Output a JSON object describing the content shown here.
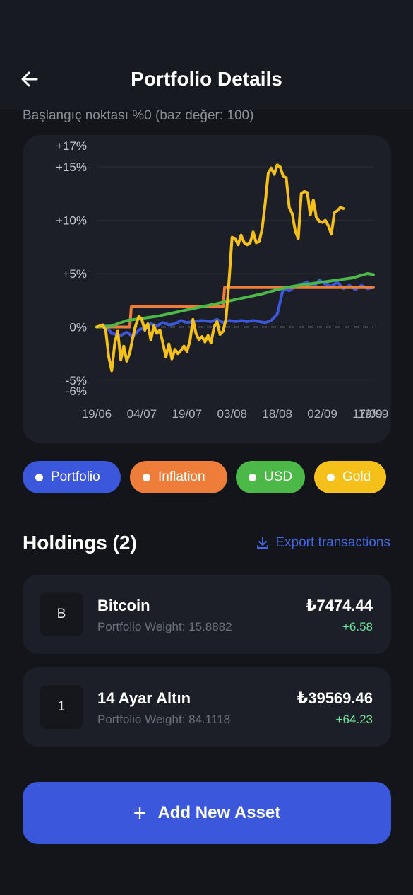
{
  "header": {
    "title": "Portfolio Details",
    "back_icon": "arrow-left-icon"
  },
  "subtitle": "Başlangıç noktası %0 (baz değer: 100)",
  "chart_data": {
    "type": "line",
    "ylim": [
      -6,
      17
    ],
    "y_ticks": [
      "+17%",
      "+15%",
      "+10%",
      "+5%",
      "0%",
      "-5%",
      "-6%"
    ],
    "y_tick_values": [
      17,
      15,
      10,
      5,
      0,
      -5,
      -6
    ],
    "gridlines": [
      15,
      10,
      5,
      -5
    ],
    "zero_line": "dashed",
    "x_ticks": [
      "19/06",
      "04/07",
      "19/07",
      "03/08",
      "18/08",
      "02/09",
      "17/09",
      "19/09"
    ],
    "x_tick_days": [
      0,
      15,
      30,
      45,
      60,
      75,
      90,
      92
    ],
    "x_range_days": [
      0,
      92
    ],
    "series": [
      {
        "name": "Portfolio",
        "color": "#3b57dc",
        "points": [
          [
            0,
            0
          ],
          [
            3,
            0.1
          ],
          [
            5,
            -0.6
          ],
          [
            8,
            -0.8
          ],
          [
            10,
            -0.5
          ],
          [
            12,
            -0.9
          ],
          [
            14,
            -0.3
          ],
          [
            16,
            0
          ],
          [
            18,
            0.3
          ],
          [
            20,
            0.1
          ],
          [
            22,
            0.4
          ],
          [
            24,
            0.2
          ],
          [
            26,
            0.3
          ],
          [
            28,
            0.6
          ],
          [
            30,
            0.4
          ],
          [
            32,
            0.5
          ],
          [
            35,
            0.6
          ],
          [
            38,
            0.5
          ],
          [
            40,
            0.7
          ],
          [
            42,
            0.4
          ],
          [
            44,
            0.6
          ],
          [
            46,
            0.5
          ],
          [
            48,
            0.6
          ],
          [
            50,
            0.5
          ],
          [
            52,
            0.6
          ],
          [
            54,
            0.5
          ],
          [
            56,
            0.4
          ],
          [
            58,
            0.6
          ],
          [
            60,
            1.2
          ],
          [
            62,
            3.6
          ],
          [
            64,
            3.4
          ],
          [
            66,
            3.8
          ],
          [
            68,
            4
          ],
          [
            70,
            4.2
          ],
          [
            72,
            3.7
          ],
          [
            74,
            4.4
          ],
          [
            76,
            4
          ],
          [
            78,
            3.8
          ],
          [
            80,
            4.2
          ],
          [
            82,
            3.6
          ],
          [
            84,
            3.9
          ],
          [
            86,
            3.5
          ],
          [
            88,
            3.9
          ],
          [
            90,
            3.6
          ],
          [
            92,
            3.7
          ]
        ]
      },
      {
        "name": "Inflation",
        "color": "#ee7d3a",
        "points": [
          [
            0,
            0
          ],
          [
            11,
            0
          ],
          [
            11.5,
            1.9
          ],
          [
            42,
            1.9
          ],
          [
            42.5,
            3.7
          ],
          [
            92,
            3.7
          ]
        ]
      },
      {
        "name": "USD",
        "color": "#4cb848",
        "points": [
          [
            0,
            0
          ],
          [
            5,
            0.1
          ],
          [
            10,
            0.6
          ],
          [
            15,
            0.8
          ],
          [
            20,
            1
          ],
          [
            25,
            1.3
          ],
          [
            30,
            1.6
          ],
          [
            35,
            1.9
          ],
          [
            40,
            2.2
          ],
          [
            45,
            2.5
          ],
          [
            50,
            2.8
          ],
          [
            55,
            3.1
          ],
          [
            60,
            3.5
          ],
          [
            65,
            3.8
          ],
          [
            70,
            4
          ],
          [
            75,
            4.2
          ],
          [
            80,
            4.4
          ],
          [
            85,
            4.6
          ],
          [
            90,
            5
          ],
          [
            92,
            4.9
          ]
        ]
      },
      {
        "name": "Gold",
        "color": "#f5c01a",
        "points": [
          [
            0,
            0
          ],
          [
            2,
            0.2
          ],
          [
            3,
            -0.3
          ],
          [
            4,
            -2.8
          ],
          [
            5,
            -4.1
          ],
          [
            6,
            -1.5
          ],
          [
            7,
            -0.4
          ],
          [
            8,
            -3.1
          ],
          [
            9,
            -1.8
          ],
          [
            10,
            -3.2
          ],
          [
            11,
            -2.4
          ],
          [
            12,
            -1
          ],
          [
            13,
            0.2
          ],
          [
            14,
            1
          ],
          [
            15,
            0.7
          ],
          [
            16,
            -0.3
          ],
          [
            17,
            0.3
          ],
          [
            18,
            -1.2
          ],
          [
            19,
            0.1
          ],
          [
            20,
            -0.6
          ],
          [
            21,
            -0.3
          ],
          [
            22,
            -1.5
          ],
          [
            23,
            -2.8
          ],
          [
            24,
            -1.6
          ],
          [
            25,
            -3
          ],
          [
            26,
            -2.1
          ],
          [
            27,
            -2.5
          ],
          [
            28,
            -2.2
          ],
          [
            29,
            -1.8
          ],
          [
            30,
            -2.3
          ],
          [
            31,
            -1.3
          ],
          [
            32,
            0.7
          ],
          [
            33,
            -0.6
          ],
          [
            34,
            -1.2
          ],
          [
            35,
            -0.9
          ],
          [
            36,
            -1.4
          ],
          [
            37,
            -0.8
          ],
          [
            38,
            -1.5
          ],
          [
            39,
            0
          ],
          [
            40,
            0.5
          ],
          [
            41,
            -0.7
          ],
          [
            42,
            -0.4
          ],
          [
            43,
            0.8
          ],
          [
            44,
            4.4
          ],
          [
            45,
            8.4
          ],
          [
            46,
            8.3
          ],
          [
            47,
            7.7
          ],
          [
            48,
            8.6
          ],
          [
            49,
            7.9
          ],
          [
            50,
            7.7
          ],
          [
            51,
            7.9
          ],
          [
            52,
            8.9
          ],
          [
            53,
            7.9
          ],
          [
            54,
            8
          ],
          [
            55,
            9.2
          ],
          [
            56,
            11.6
          ],
          [
            57,
            14.4
          ],
          [
            58,
            14.9
          ],
          [
            59,
            14.3
          ],
          [
            60,
            15.2
          ],
          [
            61,
            15
          ],
          [
            62,
            14.1
          ],
          [
            63,
            14
          ],
          [
            64,
            11.2
          ],
          [
            65,
            10.6
          ],
          [
            66,
            9
          ],
          [
            67,
            8.3
          ],
          [
            68,
            12.5
          ],
          [
            69,
            12.7
          ],
          [
            70,
            12.6
          ],
          [
            71,
            10.5
          ],
          [
            72,
            11.9
          ],
          [
            73,
            10.3
          ],
          [
            74,
            9.9
          ],
          [
            75,
            9.8
          ],
          [
            76,
            10
          ],
          [
            77,
            9.5
          ],
          [
            78,
            8.7
          ],
          [
            79,
            10.7
          ],
          [
            80,
            10.9
          ],
          [
            81,
            11.2
          ],
          [
            82,
            11.1
          ]
        ]
      }
    ]
  },
  "legend": [
    {
      "label": "Portfolio",
      "color": "#3b57dc"
    },
    {
      "label": "Inflation",
      "color": "#ee7d3a"
    },
    {
      "label": "USD",
      "color": "#4cb848"
    },
    {
      "label": "Gold",
      "color": "#f5c01a"
    }
  ],
  "holdings": {
    "title": "Holdings (2)",
    "export_label": "Export transactions",
    "items": [
      {
        "initial": "B",
        "name": "Bitcoin",
        "weight": "Portfolio Weight: 15.8882",
        "value": "₺7474.44",
        "change": "+6.58"
      },
      {
        "initial": "1",
        "name": "14 Ayar Altın",
        "weight": "Portfolio Weight: 84.1118",
        "value": "₺39569.46",
        "change": "+64.23"
      }
    ]
  },
  "add_button": {
    "label": "Add New Asset"
  },
  "colors": {
    "background": "#13151b",
    "card": "#1c1f27",
    "accent": "#3b57dc",
    "positive": "#6ee59a"
  }
}
